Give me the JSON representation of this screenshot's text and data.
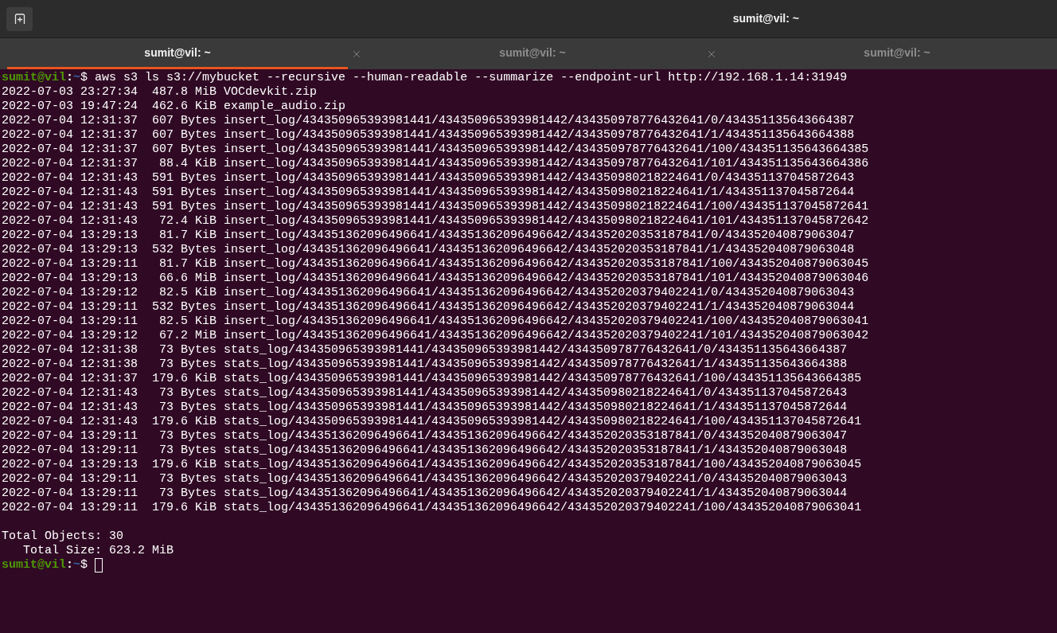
{
  "window": {
    "title": "sumit@vil: ~"
  },
  "tabs": [
    {
      "label": "sumit@vil: ~",
      "selected": true,
      "closable": true
    },
    {
      "label": "sumit@vil: ~",
      "selected": false,
      "closable": true
    },
    {
      "label": "sumit@vil: ~",
      "selected": false,
      "closable": false
    }
  ],
  "terminal": {
    "lines": [
      {
        "kind": "prompt",
        "user": "sumit@vil",
        "separator": ":",
        "path": "~",
        "symbol": "$",
        "command": "aws s3 ls s3://mybucket --recursive --human-readable --summarize --endpoint-url http://192.168.1.14:31949",
        "cursor": false
      },
      {
        "kind": "output",
        "text": "2022-07-03 23:27:34  487.8 MiB VOCdevkit.zip"
      },
      {
        "kind": "output",
        "text": "2022-07-03 19:47:24  462.6 KiB example_audio.zip"
      },
      {
        "kind": "output",
        "text": "2022-07-04 12:31:37  607 Bytes insert_log/434350965393981441/434350965393981442/434350978776432641/0/434351135643664387"
      },
      {
        "kind": "output",
        "text": "2022-07-04 12:31:37  607 Bytes insert_log/434350965393981441/434350965393981442/434350978776432641/1/434351135643664388"
      },
      {
        "kind": "output",
        "text": "2022-07-04 12:31:37  607 Bytes insert_log/434350965393981441/434350965393981442/434350978776432641/100/434351135643664385"
      },
      {
        "kind": "output",
        "text": "2022-07-04 12:31:37   88.4 KiB insert_log/434350965393981441/434350965393981442/434350978776432641/101/434351135643664386"
      },
      {
        "kind": "output",
        "text": "2022-07-04 12:31:43  591 Bytes insert_log/434350965393981441/434350965393981442/434350980218224641/0/434351137045872643"
      },
      {
        "kind": "output",
        "text": "2022-07-04 12:31:43  591 Bytes insert_log/434350965393981441/434350965393981442/434350980218224641/1/434351137045872644"
      },
      {
        "kind": "output",
        "text": "2022-07-04 12:31:43  591 Bytes insert_log/434350965393981441/434350965393981442/434350980218224641/100/434351137045872641"
      },
      {
        "kind": "output",
        "text": "2022-07-04 12:31:43   72.4 KiB insert_log/434350965393981441/434350965393981442/434350980218224641/101/434351137045872642"
      },
      {
        "kind": "output",
        "text": "2022-07-04 13:29:13   81.7 KiB insert_log/434351362096496641/434351362096496642/434352020353187841/0/434352040879063047"
      },
      {
        "kind": "output",
        "text": "2022-07-04 13:29:13  532 Bytes insert_log/434351362096496641/434351362096496642/434352020353187841/1/434352040879063048"
      },
      {
        "kind": "output",
        "text": "2022-07-04 13:29:11   81.7 KiB insert_log/434351362096496641/434351362096496642/434352020353187841/100/434352040879063045"
      },
      {
        "kind": "output",
        "text": "2022-07-04 13:29:13   66.6 MiB insert_log/434351362096496641/434351362096496642/434352020353187841/101/434352040879063046"
      },
      {
        "kind": "output",
        "text": "2022-07-04 13:29:12   82.5 KiB insert_log/434351362096496641/434351362096496642/434352020379402241/0/434352040879063043"
      },
      {
        "kind": "output",
        "text": "2022-07-04 13:29:11  532 Bytes insert_log/434351362096496641/434351362096496642/434352020379402241/1/434352040879063044"
      },
      {
        "kind": "output",
        "text": "2022-07-04 13:29:11   82.5 KiB insert_log/434351362096496641/434351362096496642/434352020379402241/100/434352040879063041"
      },
      {
        "kind": "output",
        "text": "2022-07-04 13:29:12   67.2 MiB insert_log/434351362096496641/434351362096496642/434352020379402241/101/434352040879063042"
      },
      {
        "kind": "output",
        "text": "2022-07-04 12:31:38   73 Bytes stats_log/434350965393981441/434350965393981442/434350978776432641/0/434351135643664387"
      },
      {
        "kind": "output",
        "text": "2022-07-04 12:31:38   73 Bytes stats_log/434350965393981441/434350965393981442/434350978776432641/1/434351135643664388"
      },
      {
        "kind": "output",
        "text": "2022-07-04 12:31:37  179.6 KiB stats_log/434350965393981441/434350965393981442/434350978776432641/100/434351135643664385"
      },
      {
        "kind": "output",
        "text": "2022-07-04 12:31:43   73 Bytes stats_log/434350965393981441/434350965393981442/434350980218224641/0/434351137045872643"
      },
      {
        "kind": "output",
        "text": "2022-07-04 12:31:43   73 Bytes stats_log/434350965393981441/434350965393981442/434350980218224641/1/434351137045872644"
      },
      {
        "kind": "output",
        "text": "2022-07-04 12:31:43  179.6 KiB stats_log/434350965393981441/434350965393981442/434350980218224641/100/434351137045872641"
      },
      {
        "kind": "output",
        "text": "2022-07-04 13:29:11   73 Bytes stats_log/434351362096496641/434351362096496642/434352020353187841/0/434352040879063047"
      },
      {
        "kind": "output",
        "text": "2022-07-04 13:29:11   73 Bytes stats_log/434351362096496641/434351362096496642/434352020353187841/1/434352040879063048"
      },
      {
        "kind": "output",
        "text": "2022-07-04 13:29:13  179.6 KiB stats_log/434351362096496641/434351362096496642/434352020353187841/100/434352040879063045"
      },
      {
        "kind": "output",
        "text": "2022-07-04 13:29:11   73 Bytes stats_log/434351362096496641/434351362096496642/434352020379402241/0/434352040879063043"
      },
      {
        "kind": "output",
        "text": "2022-07-04 13:29:11   73 Bytes stats_log/434351362096496641/434351362096496642/434352020379402241/1/434352040879063044"
      },
      {
        "kind": "output",
        "text": "2022-07-04 13:29:11  179.6 KiB stats_log/434351362096496641/434351362096496642/434352020379402241/100/434352040879063041"
      },
      {
        "kind": "blank"
      },
      {
        "kind": "output",
        "text": "Total Objects: 30"
      },
      {
        "kind": "output",
        "text": "   Total Size: 623.2 MiB"
      },
      {
        "kind": "prompt",
        "user": "sumit@vil",
        "separator": ":",
        "path": "~",
        "symbol": "$",
        "cursor": true
      }
    ]
  }
}
